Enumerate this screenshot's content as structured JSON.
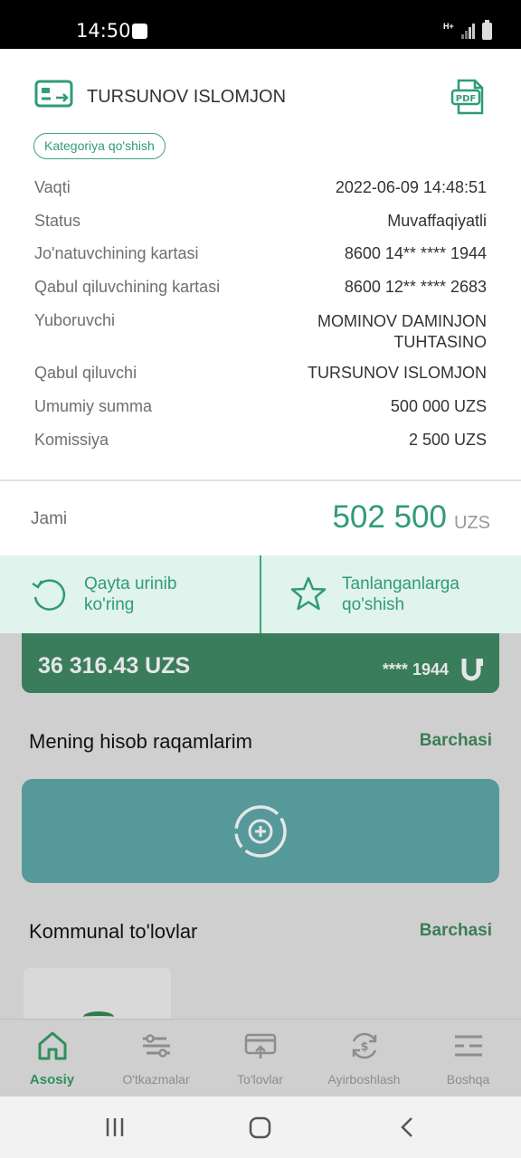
{
  "status_bar": {
    "time": "14:50",
    "network": "H+",
    "icons": [
      "wifi-icon",
      "signal-icon",
      "battery-icon"
    ]
  },
  "receipt": {
    "recipient_name": "TURSUNOV ISLOMJON",
    "category_button": "Kategoriya qo'shish",
    "pdf_icon_label": "PDF",
    "details": [
      {
        "label": "Vaqti",
        "value": "2022-06-09 14:48:51"
      },
      {
        "label": "Status",
        "value": "Muvaffaqiyatli"
      },
      {
        "label": "Jo'natuvchining kartasi",
        "value": "8600 14** **** 1944"
      },
      {
        "label": "Qabul qiluvchining kartasi",
        "value": "8600 12** **** 2683"
      },
      {
        "label": "Yuboruvchi",
        "value_line1": "MOMINOV DAMINJON",
        "value_line2": "TUHTASINO"
      },
      {
        "label": "Qabul qiluvchi",
        "value": "TURSUNOV ISLOMJON"
      },
      {
        "label": "Umumiy summa",
        "value": "500 000 UZS"
      },
      {
        "label": "Komissiya",
        "value": "2 500 UZS"
      }
    ],
    "total": {
      "label": "Jami",
      "amount": "502 500",
      "currency": "UZS"
    },
    "actions": [
      {
        "line1": "Qayta urinib",
        "line2": "ko'ring"
      },
      {
        "line1": "Tanlanganlarga",
        "line2": "qo'shish"
      }
    ]
  },
  "background": {
    "card": {
      "balance": "36 316.43 UZS",
      "masked_number": "**** 1944"
    },
    "accounts_section": {
      "title": "Mening hisob raqamlarim",
      "link": "Barchasi"
    },
    "utilities_section": {
      "title": "Kommunal to'lovlar",
      "link": "Barchasi"
    }
  },
  "bottom_nav": [
    {
      "label": "Asosiy",
      "icon": "home-icon",
      "active": true
    },
    {
      "label": "O'tkazmalar",
      "icon": "transfers-icon",
      "active": false
    },
    {
      "label": "To'lovlar",
      "icon": "payments-icon",
      "active": false
    },
    {
      "label": "Ayirboshlash",
      "icon": "exchange-icon",
      "active": false
    },
    {
      "label": "Boshqa",
      "icon": "menu-icon",
      "active": false
    }
  ],
  "colors": {
    "accent": "#2f9c74",
    "card_green": "#3a7d5a",
    "add_card_teal": "#55999b",
    "action_bg": "#e0f3ec"
  }
}
